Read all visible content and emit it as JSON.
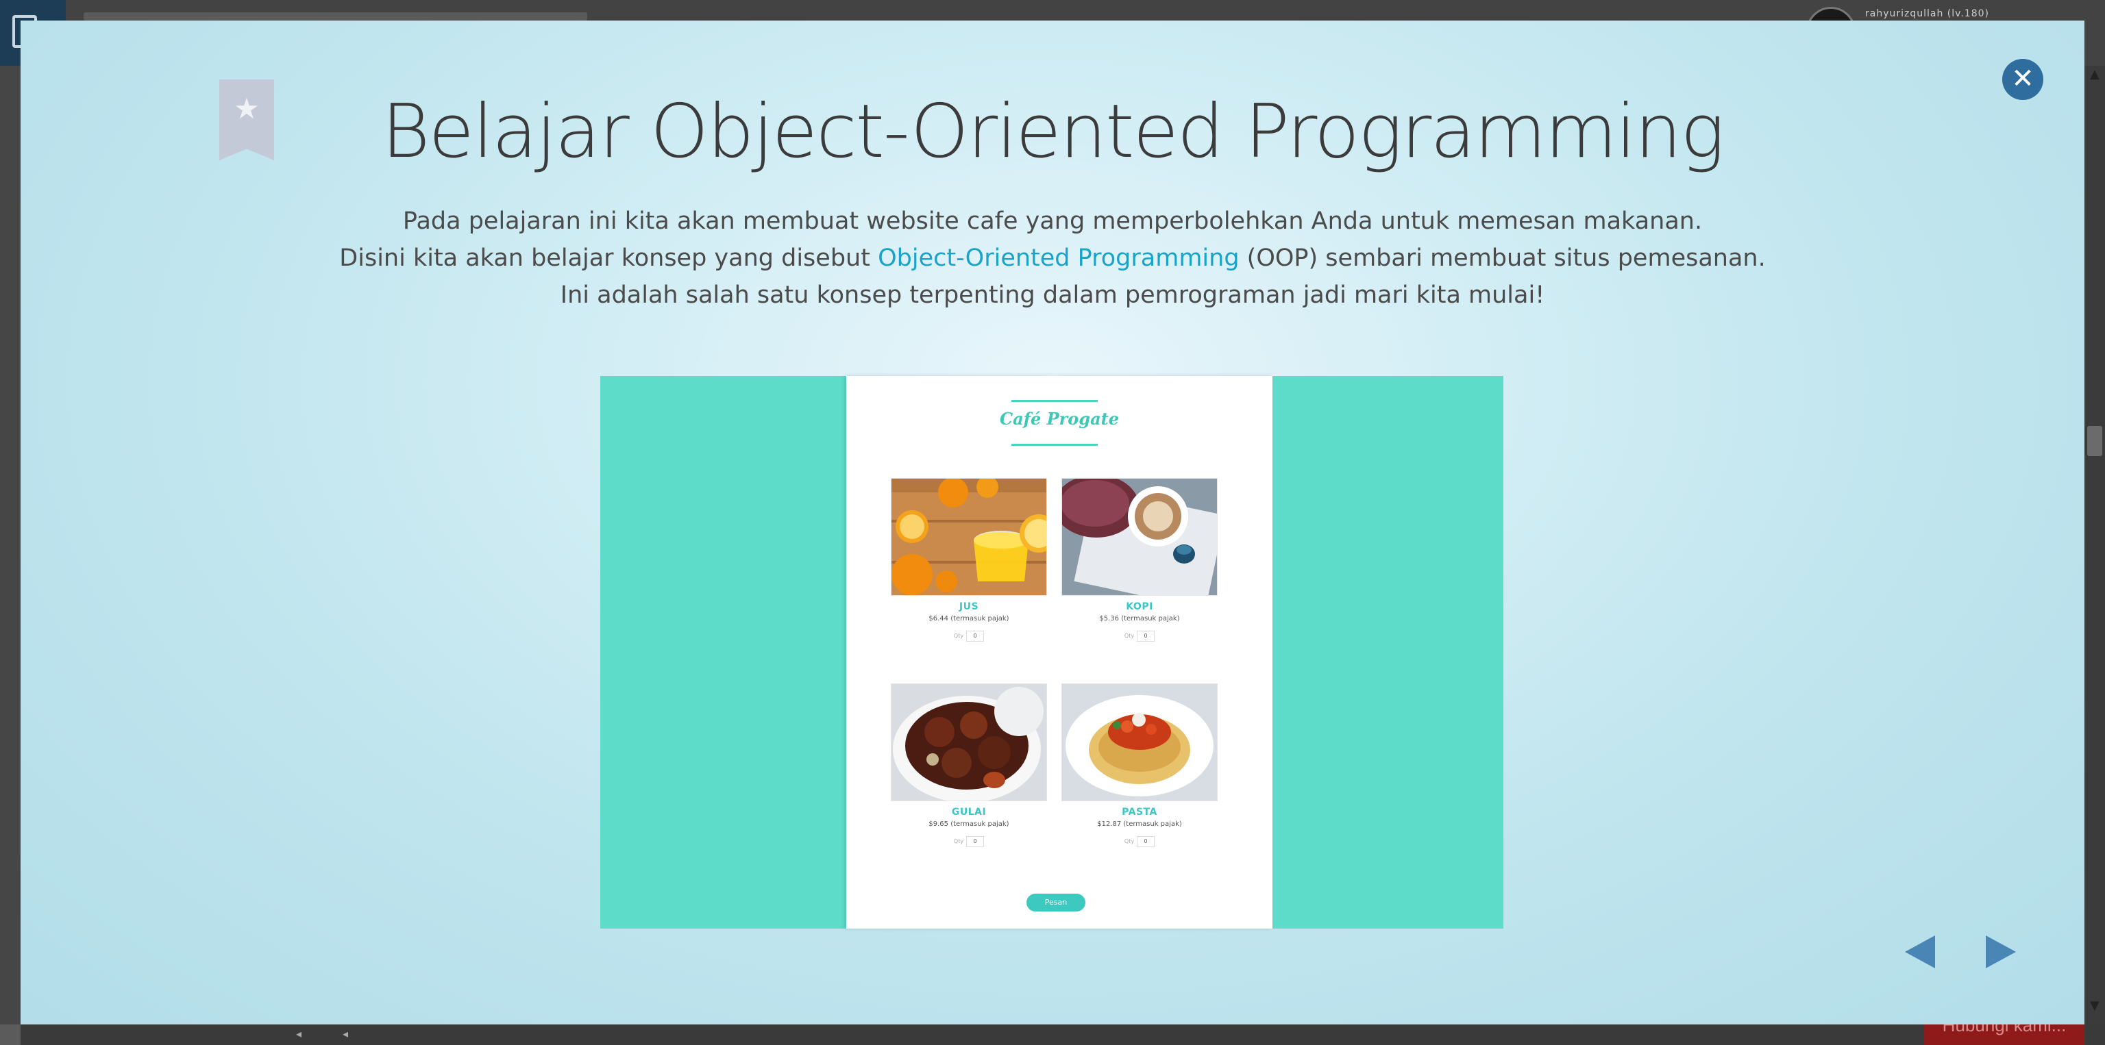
{
  "background_page": {
    "username": "rahyurizqullah (lv.180)",
    "contact_button_label": "Hubungi kami..."
  },
  "modal": {
    "title": "Belajar Object-Oriented Programming",
    "description": {
      "line1": "Pada pelajaran ini kita akan membuat website cafe yang memperbolehkan Anda untuk memesan makanan.",
      "line2_before": "Disini kita akan belajar konsep yang disebut ",
      "line2_link": "Object-Oriented Programming",
      "line2_after": " (OOP) sembari membuat situs pemesanan.",
      "line3": "Ini adalah salah satu konsep terpenting dalam pemrograman jadi mari kita mulai!"
    },
    "icons": {
      "bookmark": "bookmark-star-icon",
      "close": "close-icon",
      "prev": "arrow-left-icon",
      "next": "arrow-right-icon"
    },
    "colors": {
      "link": "#1aa3c8",
      "close_button": "#2e6d9e",
      "arrows": "#4a86b5",
      "preview_bg": "#5ddcc9",
      "cafe_accent": "#3cc6c5"
    }
  },
  "preview": {
    "logo": "Café Progate",
    "items": [
      {
        "name": "JUS",
        "price": "$6.44 (termasuk pajak)",
        "qty_label": "Qty",
        "qty": "0"
      },
      {
        "name": "KOPI",
        "price": "$5.36 (termasuk pajak)",
        "qty_label": "Qty",
        "qty": "0"
      },
      {
        "name": "GULAI",
        "price": "$9.65 (termasuk pajak)",
        "qty_label": "Qty",
        "qty": "0"
      },
      {
        "name": "PASTA",
        "price": "$12.87 (termasuk pajak)",
        "qty_label": "Qty",
        "qty": "0"
      }
    ],
    "order_button": "Pesan"
  }
}
